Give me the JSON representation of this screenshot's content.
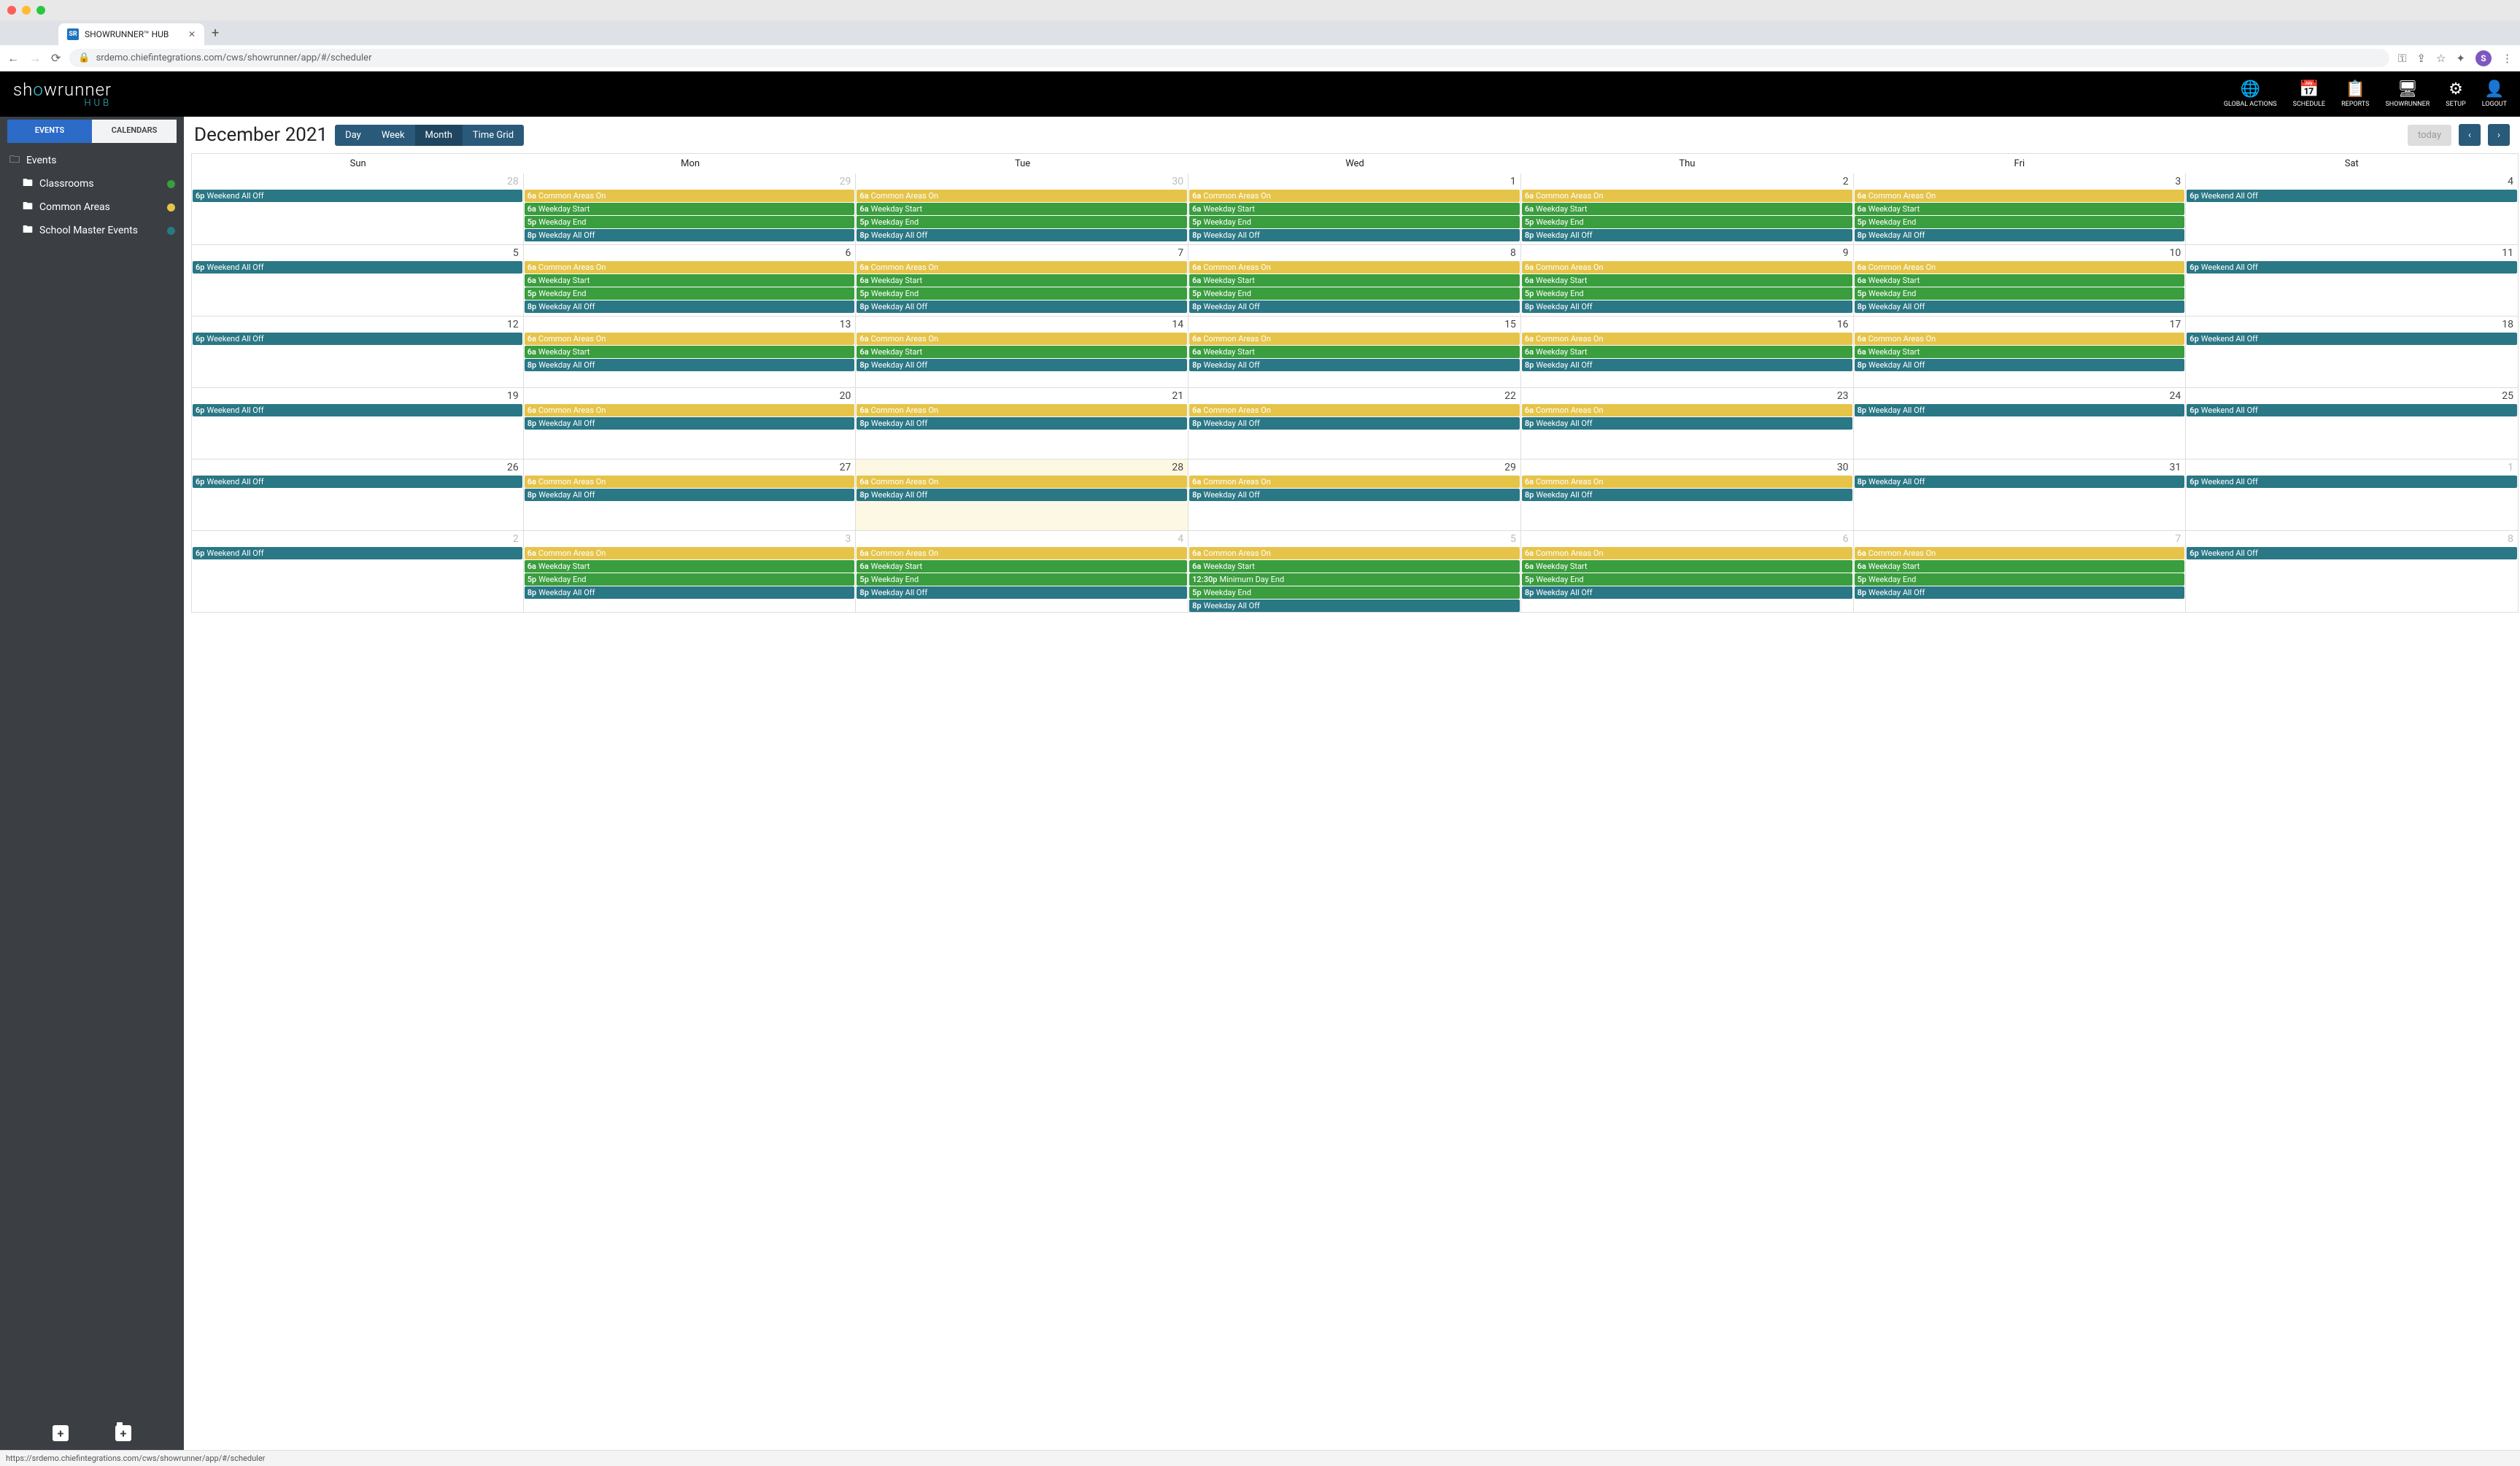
{
  "browser": {
    "tab_title": "SHOWRUNNER™ HUB",
    "tab_favicon_text": "SR",
    "url_display": "srdemo.chiefintegrations.com/cws/showrunner/app/#/scheduler",
    "avatar_letter": "S",
    "status_url": "https://srdemo.chiefintegrations.com/cws/showrunner/app/#/scheduler"
  },
  "header": {
    "logo_main_pre": "sh",
    "logo_main_accent": "o",
    "logo_main_post": "wrunner",
    "logo_sub": "HUB",
    "nav": [
      {
        "icon": "🌐",
        "label": "GLOBAL ACTIONS"
      },
      {
        "icon": "📅",
        "label": "SCHEDULE"
      },
      {
        "icon": "📋",
        "label": "REPORTS"
      },
      {
        "icon": "🖥",
        "label": "SHOWRUNNER"
      },
      {
        "icon": "⚙",
        "label": "SETUP"
      },
      {
        "icon": "👤",
        "label": "LOGOUT"
      }
    ]
  },
  "sidebar": {
    "tabs": {
      "events": "EVENTS",
      "calendars": "CALENDARS",
      "active": "events"
    },
    "root": "Events",
    "items": [
      {
        "label": "Classrooms",
        "color": "#3a9d3e"
      },
      {
        "label": "Common Areas",
        "color": "#e6c44a"
      },
      {
        "label": "School Master Events",
        "color": "#2a7785"
      }
    ]
  },
  "calendar": {
    "title": "December 2021",
    "views": [
      "Day",
      "Week",
      "Month",
      "Time Grid"
    ],
    "active_view": "Month",
    "today_label": "today",
    "day_headers": [
      "Sun",
      "Mon",
      "Tue",
      "Wed",
      "Thu",
      "Fri",
      "Sat"
    ],
    "event_types": {
      "weekend_off": {
        "time": "6p",
        "title": "Weekend All Off",
        "cls": "ev-teal"
      },
      "common_on": {
        "time": "6a",
        "title": "Common Areas On",
        "cls": "ev-yellow"
      },
      "weekday_start": {
        "time": "6a",
        "title": "Weekday Start",
        "cls": "ev-green"
      },
      "weekday_end": {
        "time": "5p",
        "title": "Weekday End",
        "cls": "ev-green"
      },
      "weekday_off": {
        "time": "8p",
        "title": "Weekday All Off",
        "cls": "ev-teal"
      },
      "min_day_end": {
        "time": "12:30p",
        "title": "Minimum Day End",
        "cls": "ev-green"
      }
    },
    "weeks": [
      [
        {
          "n": 28,
          "other": true,
          "ev": [
            "weekend_off"
          ]
        },
        {
          "n": 29,
          "other": true,
          "ev": [
            "common_on",
            "weekday_start",
            "weekday_end",
            "weekday_off"
          ]
        },
        {
          "n": 30,
          "other": true,
          "ev": [
            "common_on",
            "weekday_start",
            "weekday_end",
            "weekday_off"
          ]
        },
        {
          "n": 1,
          "ev": [
            "common_on",
            "weekday_start",
            "weekday_end",
            "weekday_off"
          ]
        },
        {
          "n": 2,
          "ev": [
            "common_on",
            "weekday_start",
            "weekday_end",
            "weekday_off"
          ]
        },
        {
          "n": 3,
          "ev": [
            "common_on",
            "weekday_start",
            "weekday_end",
            "weekday_off"
          ]
        },
        {
          "n": 4,
          "ev": [
            "weekend_off"
          ]
        }
      ],
      [
        {
          "n": 5,
          "ev": [
            "weekend_off"
          ]
        },
        {
          "n": 6,
          "ev": [
            "common_on",
            "weekday_start",
            "weekday_end",
            "weekday_off"
          ]
        },
        {
          "n": 7,
          "ev": [
            "common_on",
            "weekday_start",
            "weekday_end",
            "weekday_off"
          ]
        },
        {
          "n": 8,
          "ev": [
            "common_on",
            "weekday_start",
            "weekday_end",
            "weekday_off"
          ]
        },
        {
          "n": 9,
          "ev": [
            "common_on",
            "weekday_start",
            "weekday_end",
            "weekday_off"
          ]
        },
        {
          "n": 10,
          "ev": [
            "common_on",
            "weekday_start",
            "weekday_end",
            "weekday_off"
          ]
        },
        {
          "n": 11,
          "ev": [
            "weekend_off"
          ]
        }
      ],
      [
        {
          "n": 12,
          "ev": [
            "weekend_off"
          ]
        },
        {
          "n": 13,
          "ev": [
            "common_on",
            "weekday_start",
            "weekday_off"
          ]
        },
        {
          "n": 14,
          "ev": [
            "common_on",
            "weekday_start",
            "weekday_off"
          ]
        },
        {
          "n": 15,
          "ev": [
            "common_on",
            "weekday_start",
            "weekday_off"
          ]
        },
        {
          "n": 16,
          "ev": [
            "common_on",
            "weekday_start",
            "weekday_off"
          ]
        },
        {
          "n": 17,
          "ev": [
            "common_on",
            "weekday_start",
            "weekday_off"
          ]
        },
        {
          "n": 18,
          "ev": [
            "weekend_off"
          ]
        }
      ],
      [
        {
          "n": 19,
          "ev": [
            "weekend_off"
          ]
        },
        {
          "n": 20,
          "ev": [
            "common_on",
            "weekday_off"
          ]
        },
        {
          "n": 21,
          "ev": [
            "common_on",
            "weekday_off"
          ]
        },
        {
          "n": 22,
          "ev": [
            "common_on",
            "weekday_off"
          ]
        },
        {
          "n": 23,
          "ev": [
            "common_on",
            "weekday_off"
          ]
        },
        {
          "n": 24,
          "ev": [
            "weekday_off"
          ]
        },
        {
          "n": 25,
          "ev": [
            "weekend_off"
          ]
        }
      ],
      [
        {
          "n": 26,
          "ev": [
            "weekend_off"
          ]
        },
        {
          "n": 27,
          "ev": [
            "common_on",
            "weekday_off"
          ]
        },
        {
          "n": 28,
          "today": true,
          "ev": [
            "common_on",
            "weekday_off"
          ]
        },
        {
          "n": 29,
          "ev": [
            "common_on",
            "weekday_off"
          ]
        },
        {
          "n": 30,
          "ev": [
            "common_on",
            "weekday_off"
          ]
        },
        {
          "n": 31,
          "ev": [
            "weekday_off"
          ]
        },
        {
          "n": 1,
          "other": true,
          "ev": [
            "weekend_off"
          ]
        }
      ],
      [
        {
          "n": 2,
          "other": true,
          "ev": [
            "weekend_off"
          ]
        },
        {
          "n": 3,
          "other": true,
          "ev": [
            "common_on",
            "weekday_start",
            "weekday_end",
            "weekday_off"
          ]
        },
        {
          "n": 4,
          "other": true,
          "ev": [
            "common_on",
            "weekday_start",
            "weekday_end",
            "weekday_off"
          ]
        },
        {
          "n": 5,
          "other": true,
          "ev": [
            "common_on",
            "weekday_start",
            "min_day_end",
            "weekday_end",
            "weekday_off"
          ]
        },
        {
          "n": 6,
          "other": true,
          "ev": [
            "common_on",
            "weekday_start",
            "weekday_end",
            "weekday_off"
          ]
        },
        {
          "n": 7,
          "other": true,
          "ev": [
            "common_on",
            "weekday_start",
            "weekday_end",
            "weekday_off"
          ]
        },
        {
          "n": 8,
          "other": true,
          "ev": [
            "weekend_off"
          ]
        }
      ]
    ]
  }
}
